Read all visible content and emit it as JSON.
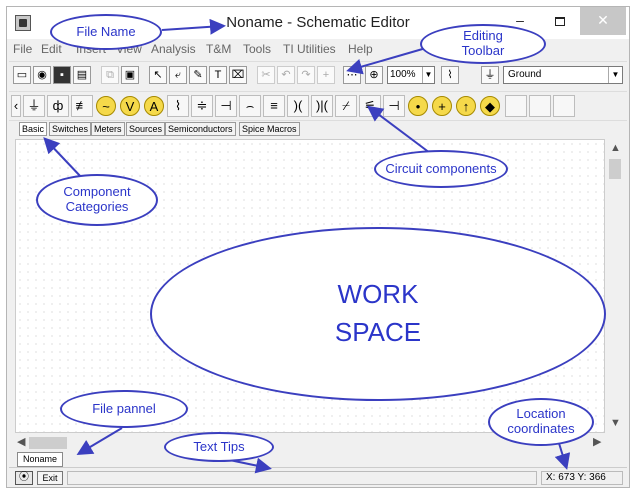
{
  "window": {
    "title": "Noname - Schematic Editor",
    "controls": {
      "minimize": "–",
      "close": "✕"
    }
  },
  "menu": [
    "File",
    "Edit",
    "Insert",
    "View",
    "Analysis",
    "T&M",
    "Tools",
    "TI Utilities",
    "Help"
  ],
  "toolbar": {
    "zoom_value": "100%",
    "ground_value": "Ground",
    "text_tool": "T"
  },
  "category_tabs": [
    "Basic",
    "Switches",
    "Meters",
    "Sources",
    "Semiconductors",
    "Spice Macros"
  ],
  "file_panel": {
    "tab_label": "Noname"
  },
  "statusbar": {
    "exit_label": "Exit",
    "coordinates": "X: 673  Y: 366"
  },
  "annotations": {
    "file_name": "File Name",
    "editing_toolbar": "Editing\nToolbar",
    "component_categories": "Component\nCategories",
    "circuit_components": "Circuit components",
    "work_space": "WORK\nSPACE",
    "file_panel": "File pannel",
    "text_tips": "Text Tips",
    "location_coordinates": "Location\ncoordinates"
  },
  "colors": {
    "annotation": "#3b3fbf",
    "component_fill": "#f5d94a"
  }
}
